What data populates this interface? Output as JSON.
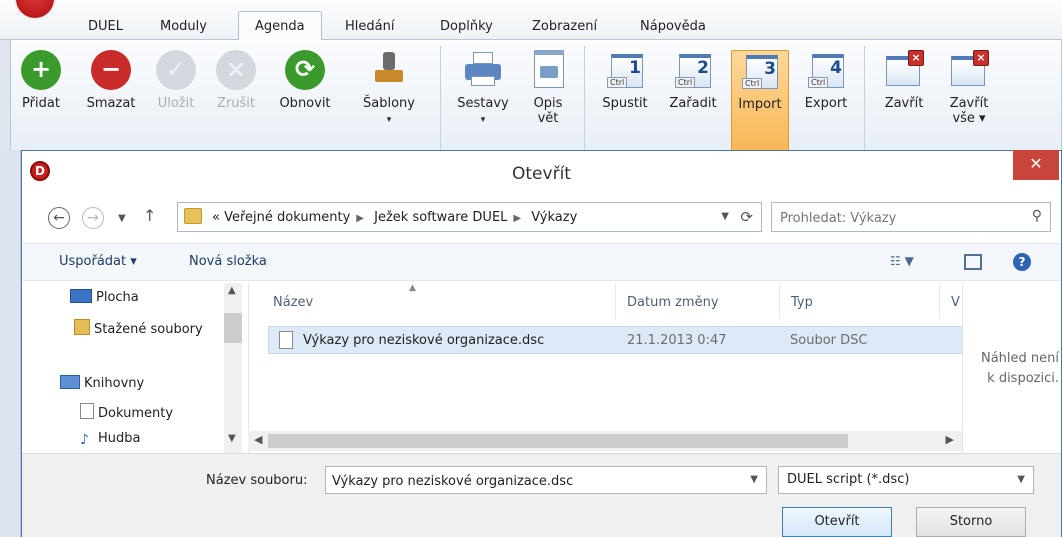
{
  "app": {
    "menu": [
      "DUEL",
      "Moduly",
      "Agenda",
      "Hledání",
      "Doplňky",
      "Zobrazení",
      "Nápověda"
    ],
    "active_menu": "Agenda",
    "ribbon": {
      "pridat": "Přidat",
      "smazat": "Smazat",
      "ulozit": "Uložit",
      "zrusit": "Zrušit",
      "obnovit": "Obnovit",
      "sablony": "Šablony",
      "sestavy": "Sestavy",
      "opis_1": "Opis",
      "opis_2": "vět",
      "spustit": "Spustit",
      "zaradit": "Zařadit",
      "import": "Import",
      "export": "Export",
      "zavrit": "Zavřít",
      "zavrit_vse_1": "Zavřít",
      "zavrit_vse_2": "vše ▾",
      "num1": "1",
      "num2": "2",
      "num3": "3",
      "num4": "4",
      "ctrl": "Ctrl"
    },
    "colors": {
      "add": "#3a9a2c",
      "delete": "#c92a2a",
      "refresh": "#3a9a2c",
      "selected": "#f8b653"
    }
  },
  "dialog": {
    "title": "Otevřít",
    "close_glyph": "✕",
    "breadcrumb": [
      "Veřejné dokumenty",
      "Ježek software DUEL",
      "Výkazy"
    ],
    "breadcrumb_prefix": "«",
    "search_placeholder": "Prohledat: Výkazy",
    "toolbar": {
      "organize": "Uspořádat ▾",
      "new_folder": "Nová složka",
      "help": "?"
    },
    "nav": [
      {
        "label": "Plocha",
        "icon": "desktop-icon"
      },
      {
        "label": "Stažené soubory",
        "icon": "downloads-icon"
      },
      {
        "label": "Knihovny",
        "icon": "libraries-icon"
      },
      {
        "label": "Dokumenty",
        "icon": "documents-icon"
      },
      {
        "label": "Hudba",
        "icon": "music-icon"
      }
    ],
    "columns": {
      "name": "Název",
      "date": "Datum změny",
      "type": "Typ",
      "size": "V"
    },
    "files": [
      {
        "name": "Výkazy pro neziskové organizace.dsc",
        "date": "21.1.2013 0:47",
        "type": "Soubor DSC"
      }
    ],
    "preview": {
      "line1": "Náhled není",
      "line2": "k dispozici."
    },
    "filename_label": "Název souboru:",
    "filename_value": "Výkazy pro neziskové organizace.dsc",
    "filetype_value": "DUEL script (*.dsc)",
    "open_button": "Otevřít",
    "cancel_button": "Storno"
  }
}
